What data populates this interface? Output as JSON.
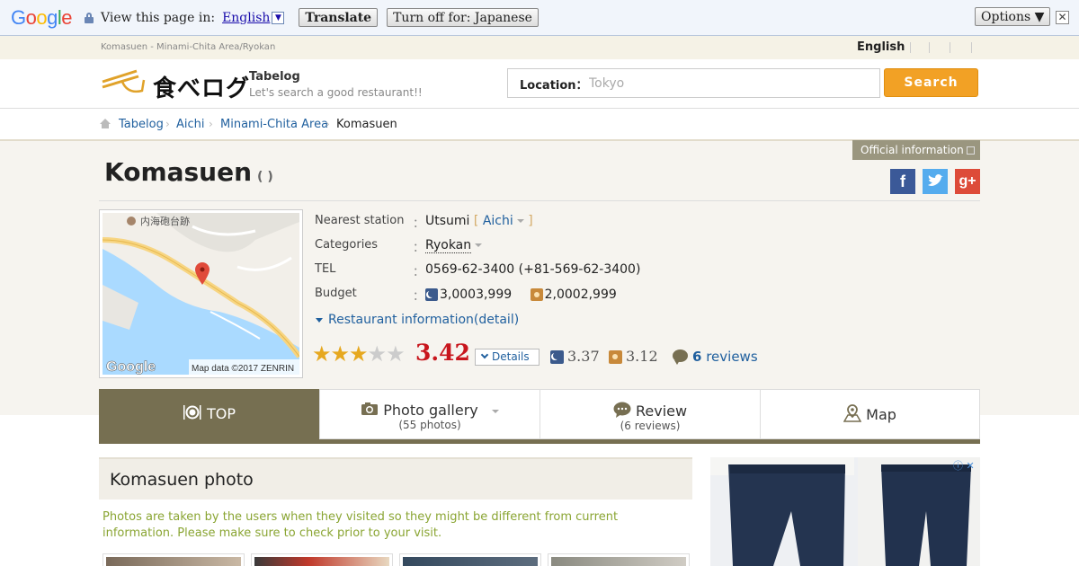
{
  "translate_bar": {
    "logo_letters": [
      "G",
      "o",
      "o",
      "g",
      "l",
      "e"
    ],
    "logo_colors": [
      "#4285f4",
      "#ea4335",
      "#fbbc05",
      "#4285f4",
      "#34a853",
      "#ea4335"
    ],
    "view_text": "View this page in:",
    "language": "English",
    "translate_label": "Translate",
    "turn_off_label": "Turn off for: Japanese",
    "options_label": "Options ▼",
    "close_label": "✕"
  },
  "top_bar": {
    "site_crumb": "Komasuen - Minami-Chita Area/Ryokan",
    "language": "English"
  },
  "header": {
    "logo_text": "食べログ",
    "brand": "Tabelog",
    "slogan": "Let's search a good restaurant!!",
    "location_label": "Location：",
    "location_placeholder": "Tokyo",
    "search_label": "Search"
  },
  "breadcrumb": {
    "items": [
      "Tabelog",
      "Aichi",
      "Minami-Chita Area",
      "Komasuen"
    ]
  },
  "restaurant": {
    "official_info": "Official information",
    "name": "Komasuen",
    "name_paren": "( )",
    "social": [
      {
        "icon": "facebook-icon",
        "glyph": "f",
        "color": "#3b5998"
      },
      {
        "icon": "twitter-icon",
        "glyph": "t",
        "color": "#55acee"
      },
      {
        "icon": "google-plus-icon",
        "glyph": "g+",
        "color": "#dd4b39"
      }
    ],
    "map": {
      "label": "内海砲台跡",
      "google": "Google",
      "map_data": "Map data ©2017 ZENRIN"
    },
    "info": {
      "station_label": "Nearest station",
      "station": "Utsumi",
      "station_area": "Aichi",
      "categories_label": "Categories",
      "category": "Ryokan",
      "tel_label": "TEL",
      "tel": "0569-62-3400 (+81-569-62-3400)",
      "budget_label": "Budget",
      "budget_dinner": "3,0003,999",
      "budget_lunch": "2,0002,999",
      "colon": "："
    },
    "detail_link": "Restaurant information(detail)",
    "rating": {
      "stars": 3,
      "max_stars": 5,
      "score": "3.42",
      "details_label": "Details",
      "dinner_score": "3.37",
      "lunch_score": "3.12",
      "review_count": "6",
      "reviews_label": "reviews"
    }
  },
  "tabs": [
    {
      "label": "TOP",
      "sub": ""
    },
    {
      "label": "Photo gallery",
      "sub": "(55 photos)"
    },
    {
      "label": "Review",
      "sub": "(6 reviews)"
    },
    {
      "label": "Map",
      "sub": ""
    }
  ],
  "photo_section": {
    "heading": "Komasuen photo",
    "note": "Photos are taken by the users when they visited so they might be different from current information. Please make sure to check prior to your visit."
  },
  "colors": {
    "accent": "#766f51",
    "search": "#f2a125",
    "score": "#c8161d",
    "link": "#1f5f9e"
  }
}
